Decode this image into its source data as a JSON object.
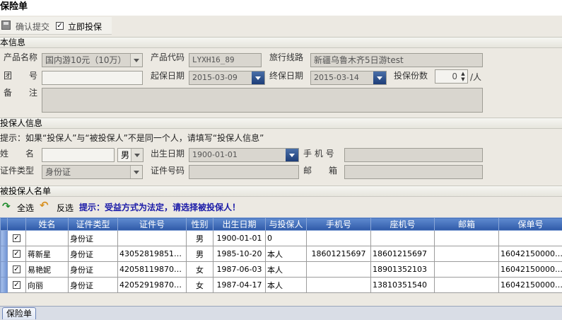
{
  "window": {
    "title": "保险单"
  },
  "toolbar": {
    "confirm_label": "确认提交",
    "immediate_label": "立即投保",
    "immediate_checked": true
  },
  "basic": {
    "section_title": "本信息",
    "product_name_label": "产品名称",
    "product_name_value": "国内游10元（10万）",
    "product_code_label": "产品代码",
    "product_code_value": "LYXH16_89",
    "route_label": "旅行线路",
    "route_value": "新疆乌鲁木齐5日游test",
    "group_no_label": "团　　号",
    "start_date_label": "起保日期",
    "start_date_value": "2015-03-09",
    "end_date_label": "终保日期",
    "end_date_value": "2015-03-14",
    "copies_label": "投保份数",
    "copies_value": "0",
    "copies_unit": "/人",
    "remark_label": "备　　注"
  },
  "applicant": {
    "section_title": "投保人信息",
    "hint": "提示：如果“投保人”与“被投保人”不是同一个人，请填写“投保人信息”",
    "name_label": "姓　　名",
    "gender_value": "男",
    "birth_label": "出生日期",
    "birth_value": "1900-01-01",
    "mobile_label": "手 机 号",
    "id_type_label": "证件类型",
    "id_type_value": "身份证",
    "id_no_label": "证件号码",
    "email_label": "邮　　箱"
  },
  "insured": {
    "section_title": "被投保人名单",
    "select_all_label": "全选",
    "invert_label": "反选",
    "hint": "提示：受益方式为法定，请选择被投保人！",
    "columns": [
      "姓名",
      "证件类型",
      "证件号",
      "性别",
      "出生日期",
      "与投保人",
      "手机号",
      "座机号",
      "邮箱",
      "保单号"
    ],
    "rows": [
      {
        "name": "",
        "id_type": "身份证",
        "id_no": "",
        "gender": "男",
        "birth": "1900-01-01",
        "relation": "0",
        "mobile": "",
        "phone": "",
        "email": "",
        "policy": ""
      },
      {
        "name": "蒋新星",
        "id_type": "身份证",
        "id_no": "43052819851…",
        "gender": "男",
        "birth": "1985-10-20",
        "relation": "本人",
        "mobile": "18601215697",
        "phone": "18601215697",
        "email": "",
        "policy": "16042150000…"
      },
      {
        "name": "易艳妮",
        "id_type": "身份证",
        "id_no": "42058119870…",
        "gender": "女",
        "birth": "1987-06-03",
        "relation": "本人",
        "mobile": "",
        "phone": "18901352103",
        "email": "",
        "policy": "16042150000…"
      },
      {
        "name": "向丽",
        "id_type": "身份证",
        "id_no": "42052919870…",
        "gender": "女",
        "birth": "1987-04-17",
        "relation": "本人",
        "mobile": "",
        "phone": "13810351540",
        "email": "",
        "policy": "16042150000…"
      }
    ]
  },
  "tabs": {
    "active_label": "保险单"
  }
}
